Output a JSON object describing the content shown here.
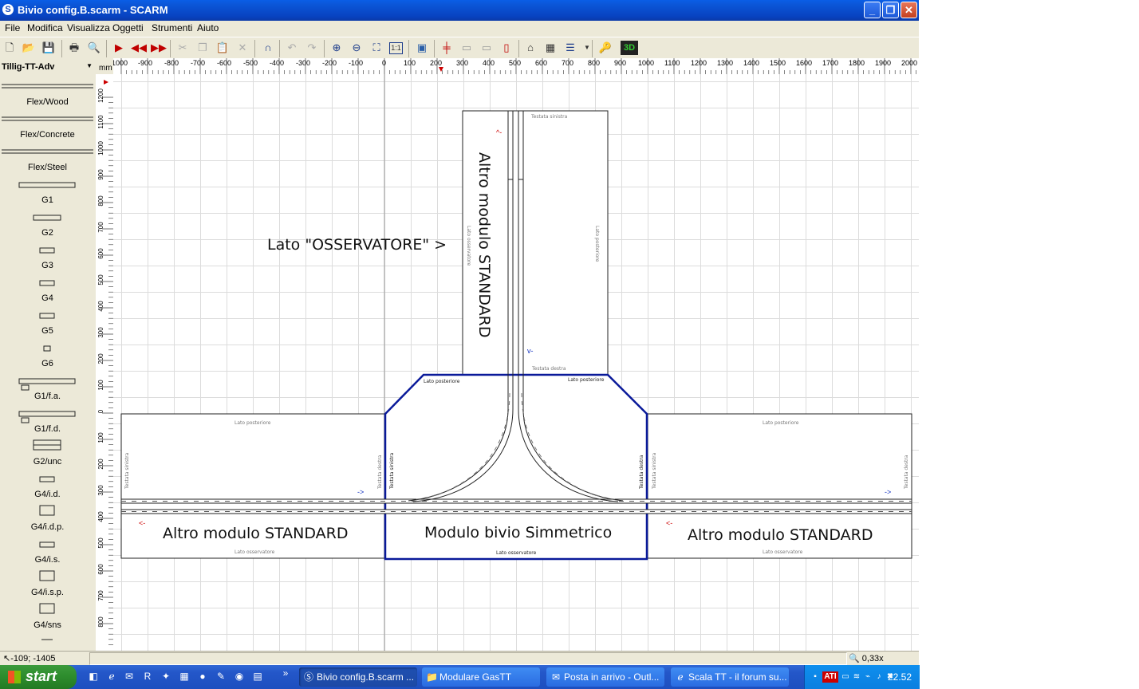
{
  "window": {
    "title": "Bivio config.B.scarm - SCARM",
    "app_icon": "S",
    "controls": [
      "minimize-icon",
      "maximize-icon",
      "close-icon"
    ]
  },
  "menu": [
    "File",
    "Modifica",
    "Visualizza",
    "Oggetti",
    "Strumenti",
    "Aiuto"
  ],
  "toolbar": {
    "tools": [
      "new-icon",
      "open-icon",
      "save-icon",
      "print-icon",
      "print-preview-icon",
      "play-icon",
      "rewind-icon",
      "fast-forward-icon",
      "cut-icon",
      "copy-icon",
      "paste-icon",
      "delete-icon",
      "magnet-icon",
      "undo-icon",
      "redo-icon",
      "zoom-in-icon",
      "zoom-out-icon",
      "zoom-fit-icon",
      "zoom-1-1-icon",
      "background-image-icon",
      "track-tool-icon",
      "object-a-icon",
      "object-b-icon",
      "object-c-icon",
      "bridge-icon",
      "tunnel-icon",
      "layers-icon",
      "properties-icon",
      "3d-view-icon"
    ],
    "zoom_1_1_label": "1:1",
    "label_3d": "3D"
  },
  "library": {
    "selected": "Tillig-TT-Adv",
    "items": [
      "Flex/Wood",
      "Flex/Concrete",
      "Flex/Steel",
      "G1",
      "G2",
      "G3",
      "G4",
      "G5",
      "G6",
      "G1/f.a.",
      "G1/f.d.",
      "G2/unc",
      "G4/i.d.",
      "G4/i.d.p.",
      "G4/i.s.",
      "G4/i.s.p.",
      "G4/sns"
    ]
  },
  "ruler": {
    "unit": "mm",
    "x_ticks": [
      "-1000",
      "-900",
      "-800",
      "-700",
      "-600",
      "-500",
      "-400",
      "-300",
      "-200",
      "-100",
      "0",
      "100",
      "200",
      "300",
      "400",
      "500",
      "600",
      "700",
      "800",
      "900",
      "1000",
      "1100",
      "1200",
      "1300",
      "1400",
      "1500",
      "1600",
      "1700",
      "1800",
      "1900",
      "2000"
    ],
    "y_ticks": [
      "1200",
      "1100",
      "1000",
      "900",
      "800",
      "700",
      "600",
      "500",
      "400",
      "300",
      "200",
      "100",
      "0",
      "100",
      "200",
      "300",
      "400",
      "500",
      "600",
      "700",
      "800"
    ]
  },
  "layout": {
    "observer_label": "Lato \"OSSERVATORE\" >",
    "top_module_label": "Altro modulo STANDARD",
    "left_module_label": "Altro modulo STANDARD",
    "center_module_label": "Modulo bivio Simmetrico",
    "right_module_label": "Altro modulo STANDARD",
    "small": {
      "testata_sinistra": "Testata sinistra",
      "testata_destra": "Testata destra",
      "lato_posteriore": "Lato posteriore",
      "lato_osservatore": "Lato osservatore"
    },
    "arrows": {
      "right": "->",
      "left": "<-",
      "up": "^-",
      "down": "v-"
    }
  },
  "status": {
    "coords": "-109; -1405",
    "zoom": "0,33x"
  },
  "taskbar": {
    "start": "start",
    "quick_more": "»",
    "tasks": [
      {
        "label": "Bivio config.B.scarm ...",
        "icon": "scarm-icon",
        "active": true
      },
      {
        "label": "Modulare GasTT",
        "icon": "folder-icon",
        "active": false
      },
      {
        "label": "Posta in arrivo - Outl...",
        "icon": "outlook-icon",
        "active": false
      },
      {
        "label": "Scala TT - il forum su...",
        "icon": "ie-icon",
        "active": false
      }
    ],
    "clock": "22.52",
    "tray_badge": "ATI"
  },
  "colors": {
    "title_blue": "#0a53d6",
    "center_module_border": "#0a1a9a",
    "arrow_red": "#cc0000",
    "arrow_blue": "#1030c0"
  }
}
